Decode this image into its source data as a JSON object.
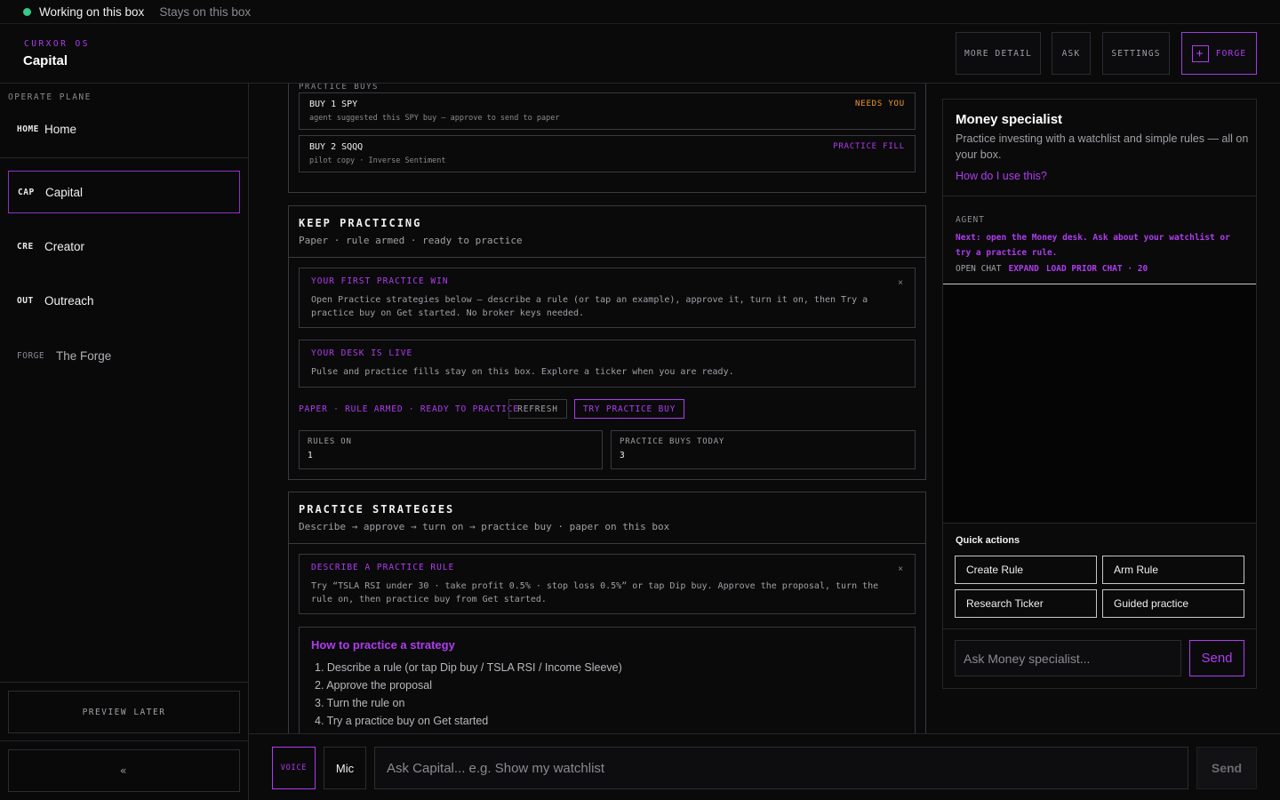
{
  "status": {
    "working": "Working on this box",
    "stays": "Stays on this box"
  },
  "header": {
    "brand_sub": "CURXOR OS",
    "title": "Capital",
    "buttons": {
      "more_detail": "MORE DETAIL",
      "ask": "ASK",
      "settings": "SETTINGS",
      "forge": "FORGE",
      "forge_icon": "+"
    }
  },
  "sidebar": {
    "plane_label": "OPERATE PLANE",
    "items": [
      {
        "code": "HOME",
        "label": "Home"
      },
      {
        "code": "CAP",
        "label": "Capital"
      },
      {
        "code": "CRE",
        "label": "Creator"
      },
      {
        "code": "OUT",
        "label": "Outreach"
      },
      {
        "code": "FORGE",
        "label": "The Forge"
      }
    ],
    "preview_later": "PREVIEW LATER",
    "collapse": "«"
  },
  "practice_buys": {
    "label": "PRACTICE BUYS",
    "items": [
      {
        "title": "BUY 1 SPY",
        "detail": "agent suggested this SPY buy — approve to send to paper",
        "badge": "NEEDS YOU",
        "badge_color": "#f29a2e"
      },
      {
        "title": "BUY 2 SQQQ",
        "detail": "pilot copy · Inverse Sentiment",
        "badge": "PRACTICE FILL",
        "badge_color": "#b03cf0"
      }
    ]
  },
  "keep_practicing": {
    "title": "KEEP PRACTICING",
    "subtitle": "Paper · rule armed · ready to practice",
    "first_win": {
      "title": "YOUR FIRST PRACTICE WIN",
      "text": "Open Practice strategies below — describe a rule (or tap an example), approve it, turn it on, then Try a practice buy on Get started. No broker keys needed.",
      "close": "×"
    },
    "desk_live": {
      "title": "YOUR DESK IS LIVE",
      "text": "Pulse and practice fills stay on this box. Explore a ticker when you are ready."
    },
    "status_line": "PAPER · RULE ARMED · READY TO PRACTICE",
    "refresh": "REFRESH",
    "try_buy": "TRY PRACTICE BUY",
    "stats": [
      {
        "label": "RULES ON",
        "value": "1"
      },
      {
        "label": "PRACTICE BUYS TODAY",
        "value": "3"
      }
    ]
  },
  "strategies": {
    "title": "PRACTICE STRATEGIES",
    "subtitle": "Describe → approve → turn on → practice buy · paper on this box",
    "describe": {
      "title": "DESCRIBE A PRACTICE RULE",
      "text": "Try “TSLA RSI under 30 · take profit 0.5% · stop loss 0.5%” or tap Dip buy. Approve the proposal, turn the rule on, then practice buy from Get started.",
      "close": "×"
    },
    "howto": {
      "title": "How to practice a strategy",
      "steps": [
        "1. Describe a rule (or tap Dip buy / TSLA RSI / Income Sleeve)",
        "2. Approve the proposal",
        "3. Turn the rule on",
        "4. Try a practice buy on Get started"
      ]
    }
  },
  "specialist": {
    "title": "Money specialist",
    "description": "Practice investing with a watchlist and simple rules — all on your box.",
    "help_link": "How do I use this?",
    "agent_label": "AGENT",
    "agent_next": "Next: open the Money desk. Ask about your watchlist or try a practice rule.",
    "open_chat": "OPEN CHAT",
    "expand": "EXPAND",
    "load_prior": "LOAD PRIOR CHAT · 20",
    "quick_actions_label": "Quick actions",
    "quick_actions": [
      "Create Rule",
      "Arm Rule",
      "Research Ticker",
      "Guided practice"
    ],
    "ask_placeholder": "Ask Money specialist...",
    "send": "Send"
  },
  "bottom": {
    "voice": "VOICE",
    "mic": "Mic",
    "placeholder": "Ask Capital... e.g. Show my watchlist",
    "send": "Send"
  }
}
